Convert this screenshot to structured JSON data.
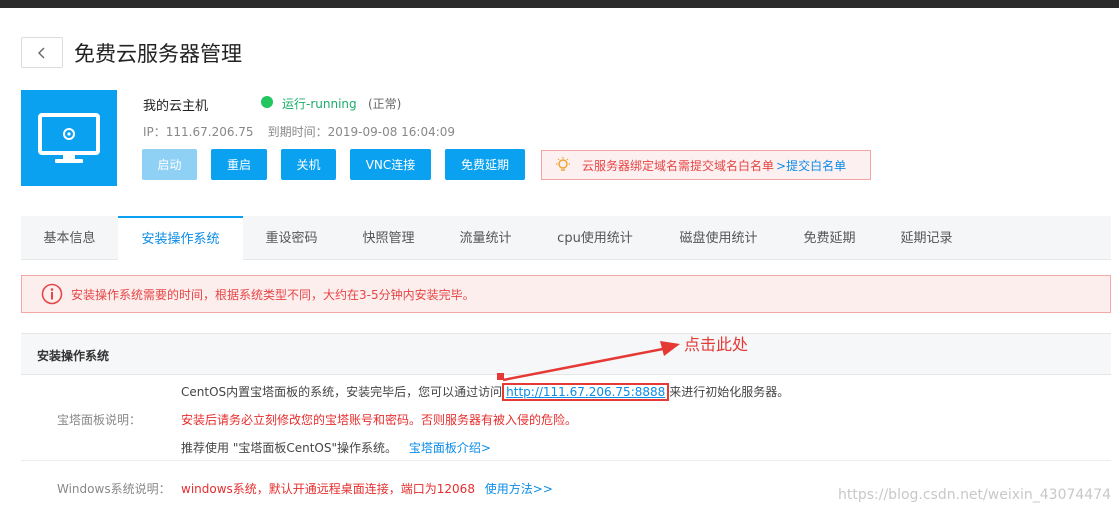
{
  "header": {
    "back_icon": "chevron-left-icon",
    "title": "免费云服务器管理"
  },
  "server": {
    "icon": "monitor-icon",
    "name": "我的云主机",
    "status": "运行-running",
    "status_note": "(正常)",
    "ip_label": "IP：111.67.206.75",
    "expire_label": "到期时间：",
    "expire_value": "2019-09-08 16:04:09"
  },
  "actions": [
    {
      "label": "启动",
      "enabled": false
    },
    {
      "label": "重启",
      "enabled": true
    },
    {
      "label": "关机",
      "enabled": true
    },
    {
      "label": "VNC连接",
      "enabled": true
    },
    {
      "label": "免费延期",
      "enabled": true
    }
  ],
  "notice": {
    "icon": "bulb-icon",
    "text": "云服务器绑定域名需提交域名白名单",
    "link": ">提交白名单"
  },
  "tabs": [
    {
      "label": "基本信息",
      "active": false
    },
    {
      "label": "安装操作系统",
      "active": true
    },
    {
      "label": "重设密码",
      "active": false
    },
    {
      "label": "快照管理",
      "active": false
    },
    {
      "label": "流量统计",
      "active": false
    },
    {
      "label": "cpu使用统计",
      "active": false
    },
    {
      "label": "磁盘使用统计",
      "active": false
    },
    {
      "label": "免费延期",
      "active": false
    },
    {
      "label": "延期记录",
      "active": false
    }
  ],
  "alert": {
    "icon": "info-circle-icon",
    "text": "安装操作系统需要的时间，根据系统类型不同，大约在3-5分钟内安装完毕。"
  },
  "section": {
    "title": "安装操作系统",
    "bt_label": "宝塔面板说明：",
    "bt_line1_a": "CentOS内置宝塔面板的系统，安装完毕后，您可以通过访问",
    "bt_url": "http://111.67.206.75:8888",
    "bt_line1_b": "来进行初始化服务器。",
    "bt_warning": "安装后请务必立刻修改您的宝塔账号和密码。否则服务器有被入侵的危险。",
    "bt_line3": "推荐使用 \"宝塔面板CentOS\"操作系统。",
    "bt_link": "宝塔面板介绍>",
    "win_label": "Windows系统说明：",
    "win_text": "windows系统，默认开通远程桌面连接，端口为12068",
    "win_link": "使用方法>>"
  },
  "annotation": {
    "text": "点击此处",
    "color": "#e53935"
  },
  "watermark": "https://blog.csdn.net/weixin_43074474",
  "colors": {
    "primary": "#0aa1f0",
    "running": "#22c55e",
    "danger": "#e64545"
  }
}
